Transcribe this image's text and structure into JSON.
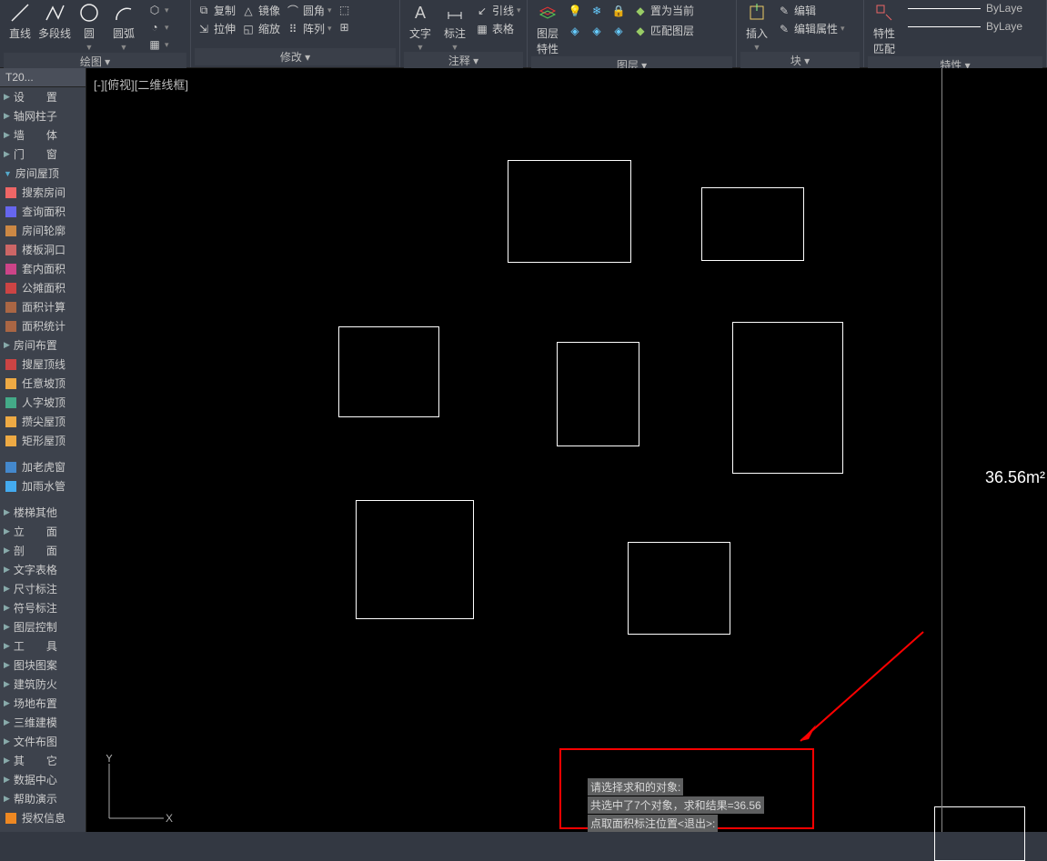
{
  "ribbon": {
    "groups": {
      "draw": "绘图 ▾",
      "modify": "修改 ▾",
      "annotate": "注释 ▾",
      "layer": "图层 ▾",
      "block": "块 ▾",
      "properties": "特性 ▾"
    },
    "line": "直线",
    "polyline": "多段线",
    "circle": "圆",
    "arc": "圆弧",
    "copy": "复制",
    "mirror": "镜像",
    "fillet": "圆角",
    "stretch": "拉伸",
    "scale": "缩放",
    "array": "阵列",
    "text": "文字",
    "dimension": "标注",
    "leader": "引线",
    "table": "表格",
    "layer_props": "图层\n特性",
    "set_current": "置为当前",
    "match_layer": "匹配图层",
    "insert": "插入",
    "edit": "编辑",
    "edit_attr": "编辑属性",
    "prop_match": "特性\n匹配",
    "bylayer": "ByLaye"
  },
  "palette": {
    "tab": "T20...",
    "items": [
      {
        "t": "tri",
        "label": "设　　置"
      },
      {
        "t": "tri",
        "label": "轴网柱子"
      },
      {
        "t": "tri",
        "label": "墙　　体"
      },
      {
        "t": "tri",
        "label": "门　　窗"
      },
      {
        "t": "tri-down",
        "label": "房间屋顶"
      },
      {
        "t": "ico",
        "c": "#e66",
        "label": "搜索房间"
      },
      {
        "t": "ico",
        "c": "#66e",
        "label": "查询面积"
      },
      {
        "t": "ico",
        "c": "#c84",
        "label": "房间轮廓"
      },
      {
        "t": "ico",
        "c": "#c66",
        "label": "楼板洞口"
      },
      {
        "t": "ico",
        "c": "#c48",
        "label": "套内面积"
      },
      {
        "t": "ico",
        "c": "#c44",
        "label": "公摊面积"
      },
      {
        "t": "ico",
        "c": "#a64",
        "label": "面积计算"
      },
      {
        "t": "ico",
        "c": "#a64",
        "label": "面积统计"
      },
      {
        "t": "tri",
        "label": "房间布置"
      },
      {
        "t": "ico",
        "c": "#c44",
        "label": "搜屋顶线"
      },
      {
        "t": "ico",
        "c": "#ea4",
        "label": "任意坡顶"
      },
      {
        "t": "ico",
        "c": "#4a8",
        "label": "人字坡顶"
      },
      {
        "t": "ico",
        "c": "#ea4",
        "label": "攒尖屋顶"
      },
      {
        "t": "ico",
        "c": "#ea4",
        "label": "矩形屋顶"
      },
      {
        "t": "blank",
        "label": ""
      },
      {
        "t": "ico",
        "c": "#48c",
        "label": "加老虎窗"
      },
      {
        "t": "ico",
        "c": "#4ae",
        "label": "加雨水管"
      },
      {
        "t": "blank",
        "label": ""
      },
      {
        "t": "tri",
        "label": "楼梯其他"
      },
      {
        "t": "tri",
        "label": "立　　面"
      },
      {
        "t": "tri",
        "label": "剖　　面"
      },
      {
        "t": "tri",
        "label": "文字表格"
      },
      {
        "t": "tri",
        "label": "尺寸标注"
      },
      {
        "t": "tri",
        "label": "符号标注"
      },
      {
        "t": "tri",
        "label": "图层控制"
      },
      {
        "t": "tri",
        "label": "工　　具"
      },
      {
        "t": "tri",
        "label": "图块图案"
      },
      {
        "t": "tri",
        "label": "建筑防火"
      },
      {
        "t": "tri",
        "label": "场地布置"
      },
      {
        "t": "tri",
        "label": "三维建模"
      },
      {
        "t": "tri",
        "label": "文件布图"
      },
      {
        "t": "tri",
        "label": "其　　它"
      },
      {
        "t": "tri",
        "label": "数据中心"
      },
      {
        "t": "tri",
        "label": "帮助演示"
      },
      {
        "t": "ico",
        "c": "#e82",
        "label": "授权信息"
      }
    ]
  },
  "viewport": {
    "label": "[-][俯视][二维线框]",
    "area_text": "36.56m²"
  },
  "command": {
    "l1": "请选择求和的对象:",
    "l2": "共选中了7个对象，求和结果=36.56",
    "l3": "点取面积标注位置<退出>:"
  },
  "ucs": {
    "x": "X",
    "y": "Y"
  }
}
